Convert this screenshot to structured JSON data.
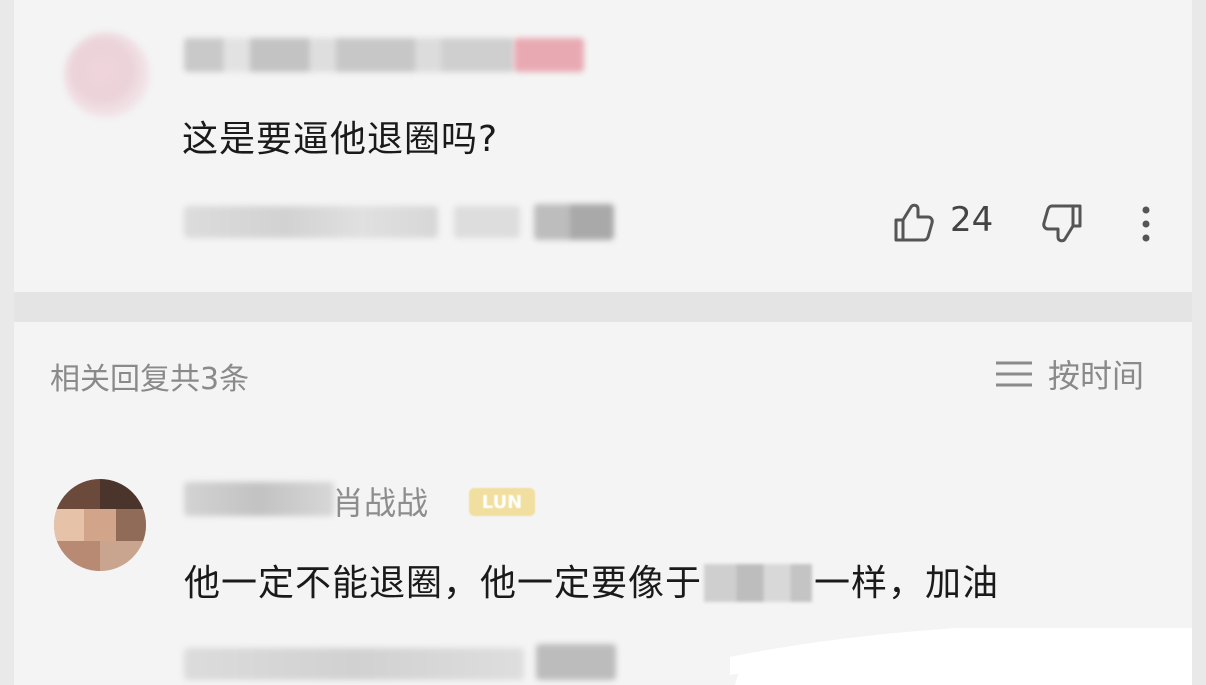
{
  "top_comment": {
    "text": "这是要逼他退圈吗?",
    "like_count": "24",
    "icons": [
      "thumbs-up-icon",
      "thumbs-down-icon",
      "more-vertical-icon"
    ]
  },
  "replies": {
    "header": "相关回复共3条",
    "sort_label": "按时间",
    "sort_icon": "list-icon",
    "items": [
      {
        "username_visible": "肖战战",
        "badge_text": "LUN",
        "text_before": "他一定不能退圈，他一定要像于",
        "text_after": "一样，加油"
      }
    ]
  },
  "colors": {
    "background": "#f4f4f4",
    "separator": "#e4e4e4",
    "text_primary": "#1a1a1a",
    "text_secondary": "#8a8a8a",
    "badge": "#f1df9f"
  }
}
